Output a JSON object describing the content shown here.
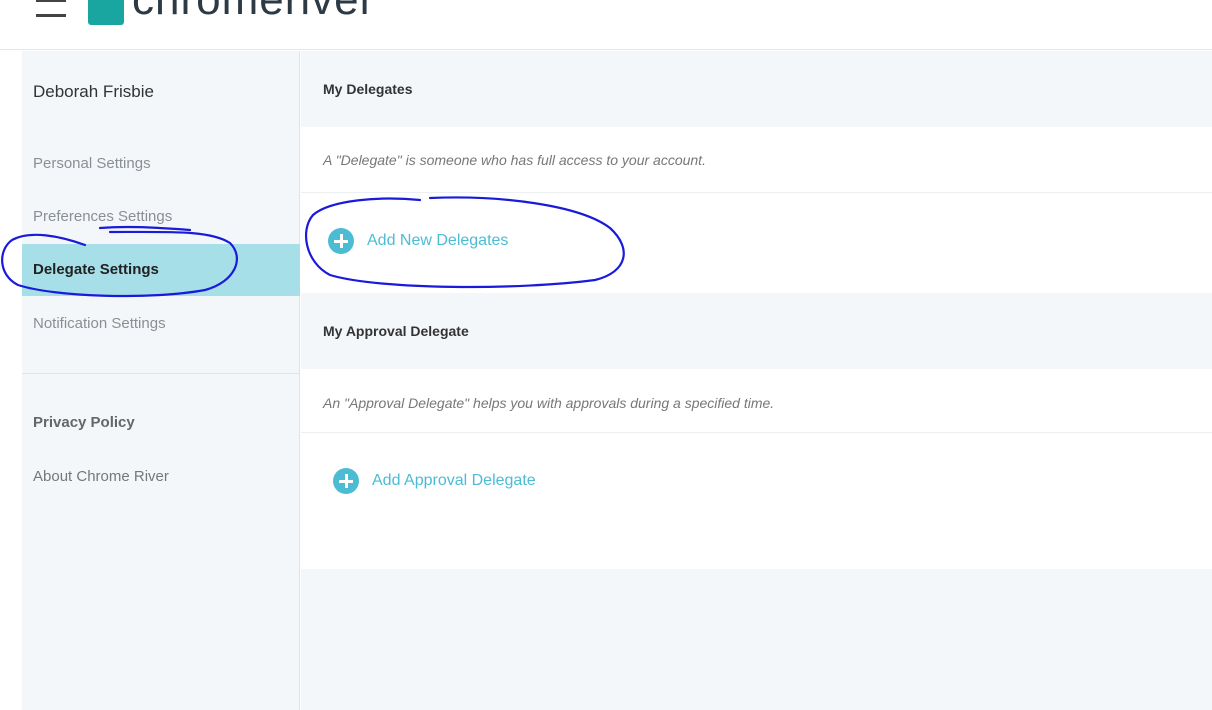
{
  "header": {
    "logo_text": "chromeriver"
  },
  "sidebar": {
    "user_name": "Deborah Frisbie",
    "items": [
      {
        "label": "Personal Settings"
      },
      {
        "label": "Preferences Settings"
      },
      {
        "label": "Delegate Settings"
      },
      {
        "label": "Notification Settings"
      }
    ],
    "privacy_policy": "Privacy Policy",
    "about": "About Chrome River"
  },
  "main": {
    "delegates": {
      "title": "My Delegates",
      "description": "A \"Delegate\" is someone who has full access to your account.",
      "add_label": "Add New Delegates"
    },
    "approval": {
      "title": "My Approval Delegate",
      "description": "An \"Approval Delegate\" helps you with approvals during a specified time.",
      "add_label": "Add Approval Delegate"
    }
  },
  "colors": {
    "accent": "#4cbcd4",
    "active_nav": "#a7dfe9",
    "annotation": "#1a1adb"
  }
}
